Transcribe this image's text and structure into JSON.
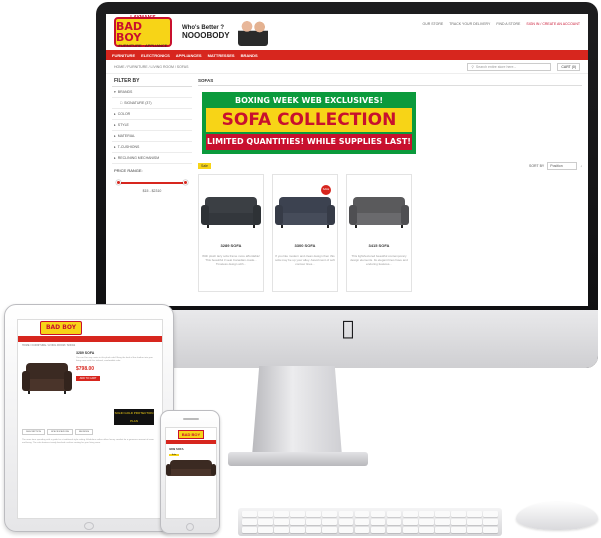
{
  "site": {
    "logo_top": "LAYMAN'S",
    "logo_main": "BAD BOY",
    "logo_sub": "FURNITURE · APPLIANCE",
    "tagline_top": "Who's Better ?",
    "tagline_main": "NOOOBODY",
    "top_links": [
      "OUR STORE",
      "TRACK YOUR DELIVERY",
      "FIND A STORE",
      "SIGN IN / CREATE AN ACCOUNT"
    ],
    "nav": [
      "FURNITURE",
      "ELECTRONICS",
      "APPLIANCES",
      "MATTRESSES",
      "BRANDS"
    ],
    "breadcrumb": "HOME / FURNITURE / LIVING ROOM / SOFAS",
    "search_placeholder": "Search entire store here...",
    "cart": "CART (0)",
    "accent_red": "#d7261e",
    "accent_yellow": "#f7d417",
    "accent_green": "#0b9a3c"
  },
  "filter": {
    "title": "FILTER BY",
    "items": [
      "BRANDS",
      "SIGNATURE (37)",
      "COLOR",
      "STYLE",
      "MATERIAL",
      "T-CUSHIONS",
      "RECLINING MECHANISM"
    ],
    "price_title": "PRICE RANGE:",
    "price_range": "$15 - $2310"
  },
  "main": {
    "title": "SOFAS",
    "banner_top": "BOXING WEEK WEB EXCLUSIVES!",
    "banner_main": "SOFA COLLECTION",
    "banner_bottom": "LIMITED QUANTITIES! WHILE SUPPLIES LAST!",
    "sale_tag": "Sale",
    "sort_label": "SORT BY",
    "sort_value": "Position",
    "products": [
      {
        "name": "3289 SOFA",
        "desc": "With plush lazy sofa frame more affordable! This beautiful 3 seat Canadian-made... Timeless design with...",
        "color": "#3b3f44"
      },
      {
        "name": "3300 SOFA",
        "desc": "If you like modern and clean design then this sofa may be up your alley. Assortment of soft contour lines...",
        "color": "#3c4250"
      },
      {
        "name": "3415 SOFA",
        "desc": "This light/textured beautiful contemporary design elements. Its elegant lines have and enduring features...",
        "color": "#5a5a5c"
      }
    ]
  },
  "ipad": {
    "product_title": "3289 SOFA",
    "product_desc": "You can't be any cozier in this plush sofa! Bring the look of fine leather into your living room with this tailored, comfortable sofa.",
    "price": "$798.00",
    "button": "ADD TO CART",
    "badge": "SOLID GOLD PROTECTION PLAN",
    "tabs": [
      "DESCRIPTION",
      "SPECIFICATIONS",
      "REVIEWS"
    ],
    "text": "The more time spending with a guide for a traditional style setting. A fabulous rather offers luxury comfort for a generous amount of room and being. The sofa features trendy brushed cushion seating for your living room."
  },
  "iphone": {
    "title": "3289 SOFA",
    "sale": "Sale"
  }
}
